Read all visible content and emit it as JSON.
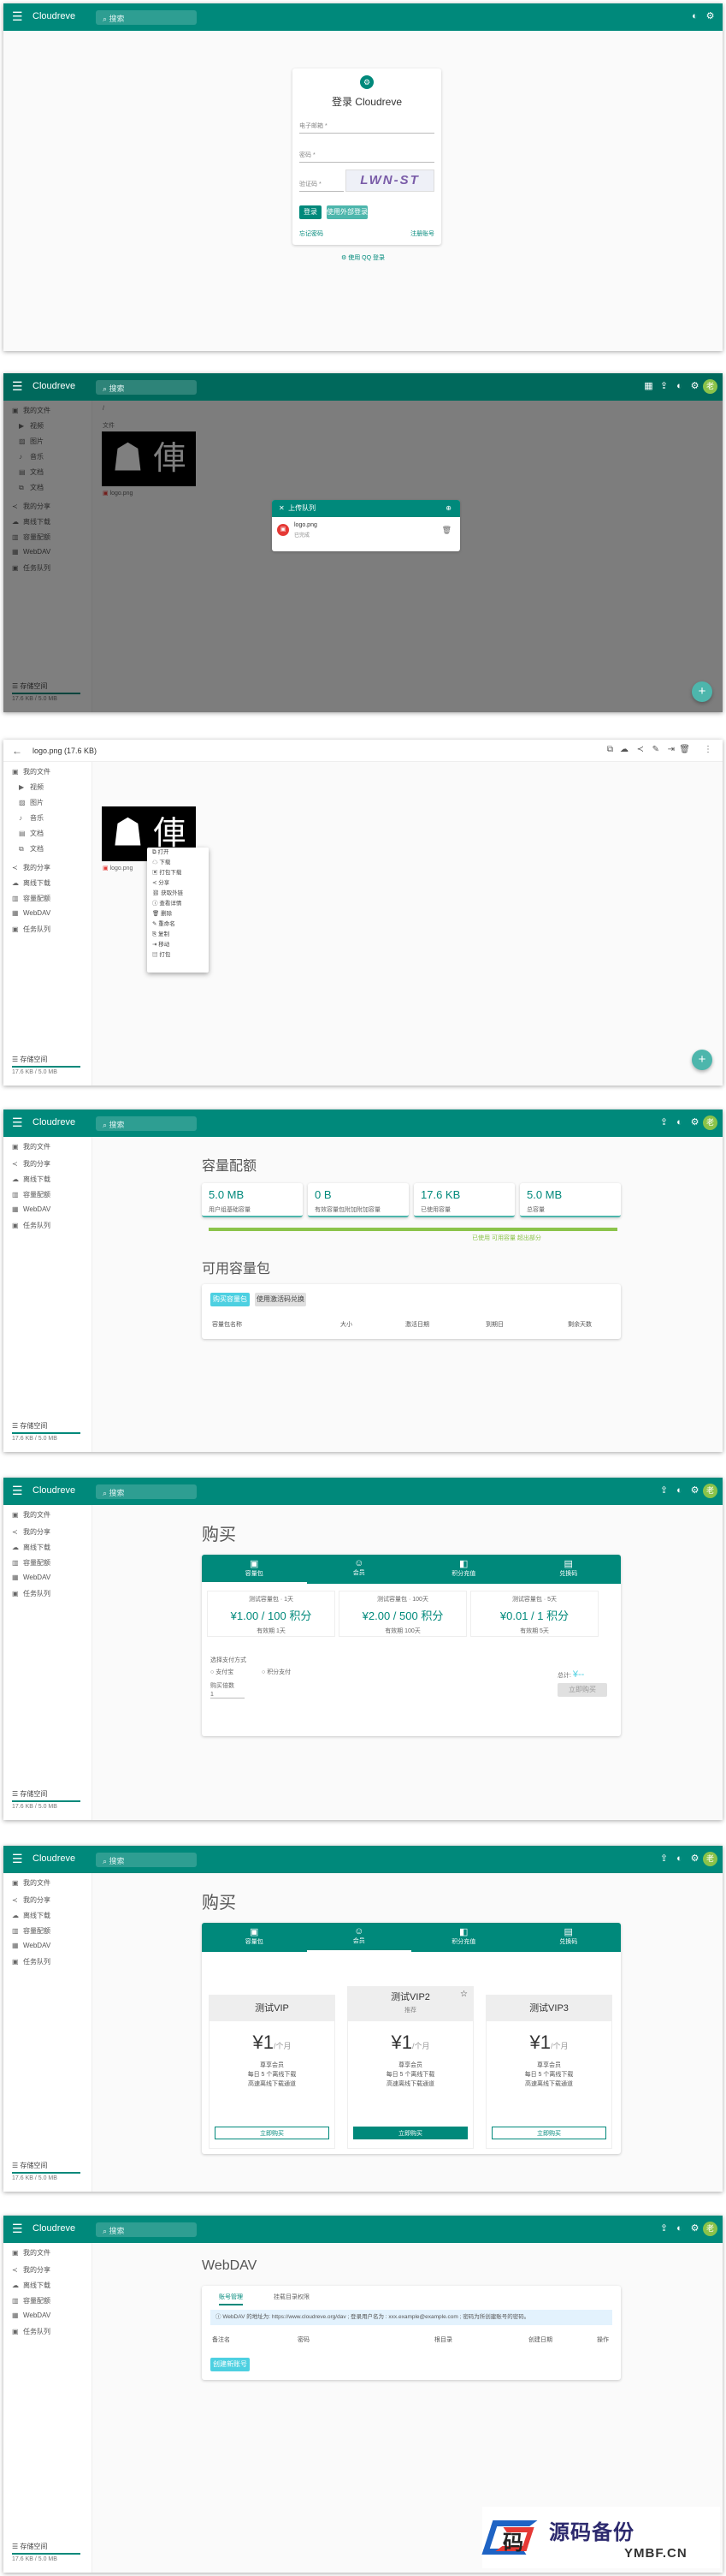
{
  "app": {
    "title": "Cloudreve",
    "search_placeholder": "搜索",
    "avatar": "老"
  },
  "login": {
    "title": "登录 Cloudreve",
    "email_label": "电子邮箱 *",
    "password_label": "密码 *",
    "captcha_label": "验证码 *",
    "captcha_text": "LWN-ST",
    "login_btn": "登录",
    "secondary_btn": "使用外部登录",
    "forgot": "忘记密码",
    "register": "注册账号",
    "footer_link": "使用 QQ 登录"
  },
  "sidebar": {
    "my_files": "我的文件",
    "video": "视频",
    "image": "图片",
    "music": "音乐",
    "doc": "文档",
    "shares": "我的分享",
    "downloads": "离线下载",
    "storage": "容量配额",
    "webdav": "WebDAV",
    "tasks": "任务队列",
    "storage_title": "存储空间",
    "storage_used": "17.6 KB / 5.0 MB"
  },
  "files": {
    "breadcrumb": "/",
    "section": "文件",
    "file_name": "logo.png",
    "upload_title": "上传队列",
    "upload_item_name": "logo.png",
    "upload_item_status": "已完成"
  },
  "preview": {
    "title": "logo.png (17.6 KB)"
  },
  "context_menu": [
    "打开",
    "下载",
    "打包下载",
    "分享",
    "获取外链",
    "查看详情",
    "删除",
    "重命名",
    "复制",
    "移动",
    "打包"
  ],
  "quota": {
    "title": "容量配额",
    "cards": [
      {
        "value": "5.0 MB",
        "label": "用户组基础容量"
      },
      {
        "value": "0 B",
        "label": "有效容量包附加附加容量"
      },
      {
        "value": "17.6 KB",
        "label": "已使用容量"
      },
      {
        "value": "5.0 MB",
        "label": "总容量"
      }
    ],
    "legend": "已使用  可用容量  超出部分",
    "packs_title": "可用容量包",
    "buy_btn": "购买容量包",
    "redeem_btn": "使用激活码兑换",
    "columns": [
      "容量包名称",
      "大小",
      "激活日期",
      "到期日",
      "剩余天数"
    ]
  },
  "buy": {
    "title": "购买",
    "tabs": [
      "容量包",
      "会员",
      "积分充值",
      "兑换码"
    ],
    "items": [
      {
        "name": "测试容量包 · 1天",
        "price": "¥1.00 / 100 积分",
        "meta": "有效期 1天"
      },
      {
        "name": "测试容量包 · 100天",
        "price": "¥2.00 / 500 积分",
        "meta": "有效期 100天"
      },
      {
        "name": "测试容量包 · 5天",
        "price": "¥0.01 / 1 积分",
        "meta": "有效期 5天"
      }
    ],
    "pay_title": "选择支付方式",
    "pay_options": [
      "支付宝",
      "积分支付"
    ],
    "qty_label": "购买倍数",
    "qty": "1",
    "total_label": "总计:",
    "total": "¥--",
    "pay_btn": "立即购买"
  },
  "vip": {
    "title": "购买",
    "tabs": [
      "容量包",
      "会员",
      "积分充值",
      "兑换码"
    ],
    "packs": [
      {
        "name": "测试VIP",
        "sub": "",
        "price": "¥1",
        "unit": "/个月",
        "desc": [
          "尊享会员",
          "每日 5 个离线下载",
          "高速离线下载通道"
        ],
        "btn": "立即购买"
      },
      {
        "name": "测试VIP2",
        "sub": "推荐",
        "price": "¥1",
        "unit": "/个月",
        "desc": [
          "尊享会员",
          "每日 5 个离线下载",
          "高速离线下载通道"
        ],
        "btn": "立即购买"
      },
      {
        "name": "测试VIP3",
        "sub": "",
        "price": "¥1",
        "unit": "/个月",
        "desc": [
          "尊享会员",
          "每日 5 个离线下载",
          "高速离线下载通道"
        ],
        "btn": "立即购买"
      }
    ]
  },
  "webdav": {
    "title": "WebDAV",
    "tabs": [
      "账号管理",
      "挂载目录权限"
    ],
    "info": "WebDAV 的地址为: https://www.cloudreve.org/dav ; 登录用户名为 : xxx.example@example.com ; 密码为所创建账号的密码。",
    "columns": [
      "备注名",
      "密码",
      "根目录",
      "创建日期",
      "操作"
    ],
    "create_btn": "创建新账号"
  },
  "watermark": {
    "glyph": "码",
    "cn": "源码备份",
    "en": "YMBF.CN"
  }
}
